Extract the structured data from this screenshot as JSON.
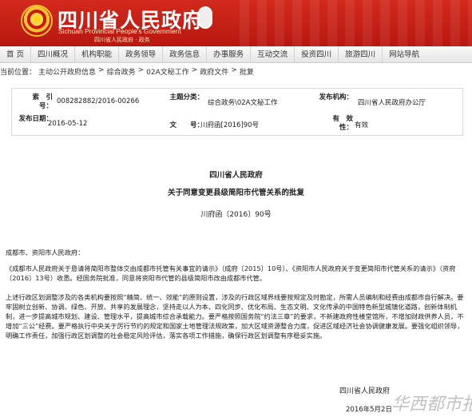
{
  "header": {
    "title": "四川省人民政府",
    "subtitle": "Sichuan Provincial People's Government",
    "tagline": "四川省人民政府 · 政务"
  },
  "nav": {
    "items": [
      "首 页",
      "四川概况",
      "机构职能",
      "政务领导",
      "政务信息",
      "办事服务",
      "互动交流",
      "投资四川",
      "旅游四川",
      "网站导航"
    ]
  },
  "breadcrumb": {
    "items": [
      "当前位置：",
      "主动公开政府信息",
      ">",
      "综合政务",
      ">",
      "02A文秘工作",
      ">",
      "政府文件",
      ">",
      "批复"
    ]
  },
  "meta": {
    "index_label": "索　引　号：",
    "index_value": "008282882/2016-00266",
    "topic_label": "主题分类：",
    "topic_value": "综合政务\\02A文秘工作",
    "issuer_label": "发布机构：",
    "issuer_value": "四川省人民政府办公厅",
    "date_label": "发布日期：",
    "date_value": "2016-05-12",
    "docno_label": "文　　号：",
    "docno_value": "川府函[2016]90号",
    "valid_label": "有　效　性：",
    "valid_value": "有效"
  },
  "document": {
    "org": "四川省人民政府",
    "title": "关于同意变更县级简阳市代管关系的批复",
    "number": "川府函〔2016〕90号",
    "addressee": "成都市、资阳市人民政府：",
    "para1": "《成都市人民政府关于恳请将简阳市整体交由成都市托管有关事宜的请示》（成府〔2015〕10号）、《资阳市人民政府关于变更简阳市代管关系的请示》（资府〔2016〕13号）收悉。经国务院批准，同意将资阳市代管的县级简阳市改由成都市代管。",
    "para2": "上述行政区划调整涉及的各类机构要按照“精简、统一、效能”的原则设置，涉及的行政区域界线要按规定及时勘定，所需人员编制和经费由成都市自行解决。要牢固树立创新、协调、绿色、开放、共享的发展理念，坚持走以人为本、四化同步、优化布局、生态文明、文化传承的中国特色新型城镇化道路，创新体制机制，进一步提高城市规划、建设、管理水平，提高城市综合承载能力。要严格按照国务院“约法三章”的要求，不新建政府性楼堂馆所，不增加财政供养人员，不增加“三公”经费。要严格执行中央关于厉行节约的规定和国家土地管理法规政策，加大区域资源整合力度，促进区域经济社会协调健康发展。要强化组织领导，明确工作责任，加强行政区划调整的社会稳定风险评估，落实各项工作措施，确保行政区划调整有序稳妥实施。",
    "sign_org": "四川省人民政府",
    "sign_date": "2016年5月2日",
    "watermark": "华西都市报"
  },
  "colors": {
    "banner": "#c81a10",
    "nav_bg": "#eeeeee"
  }
}
